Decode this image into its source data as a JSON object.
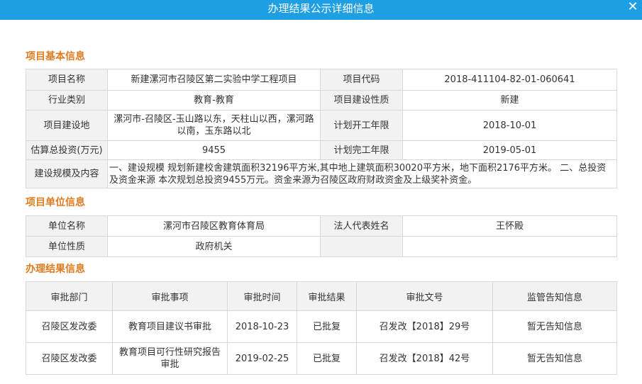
{
  "window": {
    "title": "办理结果公示详细信息",
    "close_glyph": "✕"
  },
  "basic_info": {
    "section_title": "项目基本信息",
    "rows": [
      {
        "l1": "项目名称",
        "v1": "新建漯河市召陵区第二实验中学工程项目",
        "l2": "项目代码",
        "v2": "2018-411104-82-01-060641"
      },
      {
        "l1": "行业类别",
        "v1": "教育-教育",
        "l2": "项目建设性质",
        "v2": "新建"
      },
      {
        "l1": "项目建设地",
        "v1": "漯河市-召陵区-玉山路以东，天柱山以西，漯河路以南，玉东路以北",
        "l2": "计划开工年限",
        "v2": "2018-10-01"
      },
      {
        "l1": "估算总投资(万元)",
        "v1": "9455",
        "l2": "计划完工年限",
        "v2": "2019-05-01"
      }
    ],
    "scope_label": "建设规模及内容",
    "scope_value": "一、建设规模 规划新建校舍建筑面积32196平方米,其中地上建筑面积30020平方米，地下面积2176平方米。 二、总投资及资金来源 本次规划总投资9455万元。资金来源为召陵区政府财政资金及上级奖补资金。"
  },
  "unit_info": {
    "section_title": "项目单位信息",
    "rows": [
      {
        "l1": "单位名称",
        "v1": "漯河市召陵区教育体育局",
        "l2": "法人代表姓名",
        "v2": "王怀殿"
      },
      {
        "l1": "单位性质",
        "v1": "政府机关",
        "l2": "",
        "v2": ""
      }
    ]
  },
  "results": {
    "section_title": "办理结果信息",
    "headers": [
      "审批部门",
      "审批事项",
      "审批时间",
      "审批结果",
      "审批文号",
      "监管告知信息"
    ],
    "rows": [
      [
        "召陵区发改委",
        "教育项目建议书审批",
        "2018-10-23",
        "已批复",
        "召发改【2018】29号",
        "暂无告知信息"
      ],
      [
        "召陵区发改委",
        "教育项目可行性研究报告审批",
        "2019-02-25",
        "已批复",
        "召发改【2018】42号",
        "暂无告知信息"
      ]
    ]
  },
  "colors": {
    "titlebar": "#1e9fe3",
    "section_title": "#e07b1f",
    "label_bg": "#f2f2f2",
    "border": "#d8d8d8"
  }
}
